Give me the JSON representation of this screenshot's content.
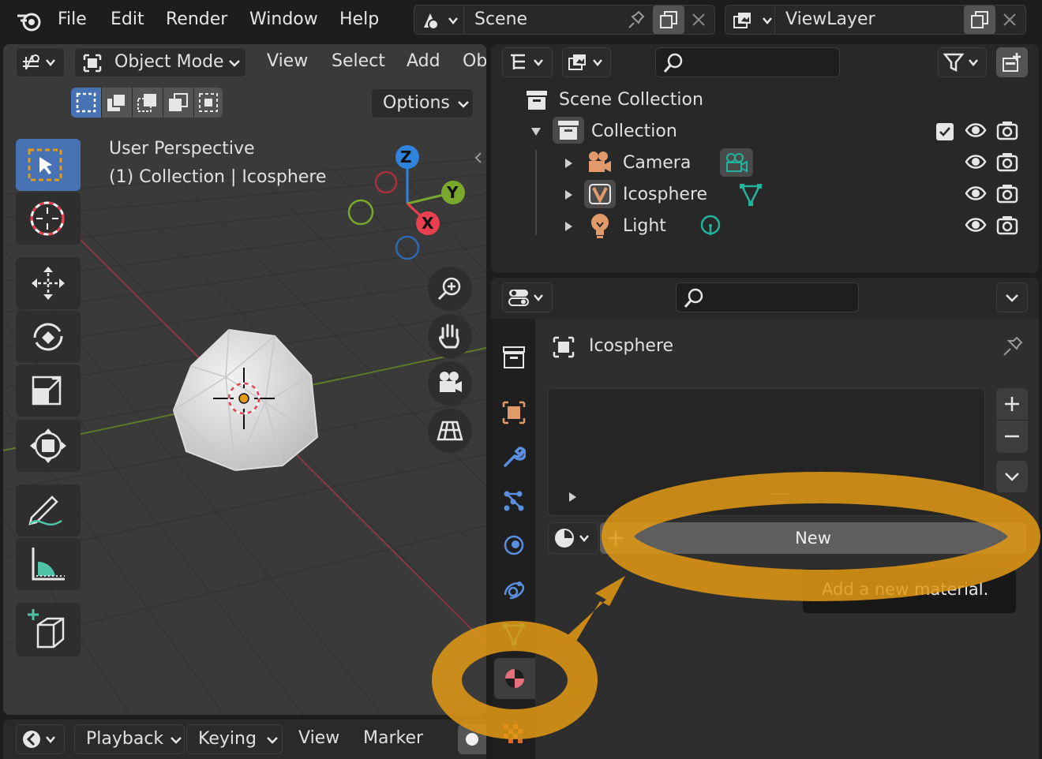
{
  "topbar": {
    "menus": [
      "File",
      "Edit",
      "Render",
      "Window",
      "Help"
    ],
    "scene_label": "Scene",
    "viewlayer_label": "ViewLayer"
  },
  "viewport": {
    "mode_label": "Object Mode",
    "menus": [
      "View",
      "Select",
      "Add",
      "Ob"
    ],
    "options_label": "Options",
    "perspective_label": "User Perspective",
    "collection_label": "(1) Collection | Icosphere",
    "gizmo": {
      "x": "X",
      "y": "Y",
      "z": "Z"
    }
  },
  "outliner": {
    "scene_collection": "Scene Collection",
    "collection": "Collection",
    "items": [
      {
        "label": "Camera"
      },
      {
        "label": "Icosphere"
      },
      {
        "label": "Light"
      }
    ]
  },
  "properties": {
    "object_name": "Icosphere",
    "new_label": "New",
    "tooltip": "Add a new material."
  },
  "timeline": {
    "menus": [
      "Playback",
      "Keying",
      "View",
      "Marker"
    ]
  },
  "colors": {
    "accent_orange": "#e39a14",
    "blue_selected": "#4772b3",
    "x_axis": "#e8404f",
    "y_axis": "#7aa82c",
    "z_axis": "#2f83dd",
    "teal_data": "#22b39c"
  }
}
